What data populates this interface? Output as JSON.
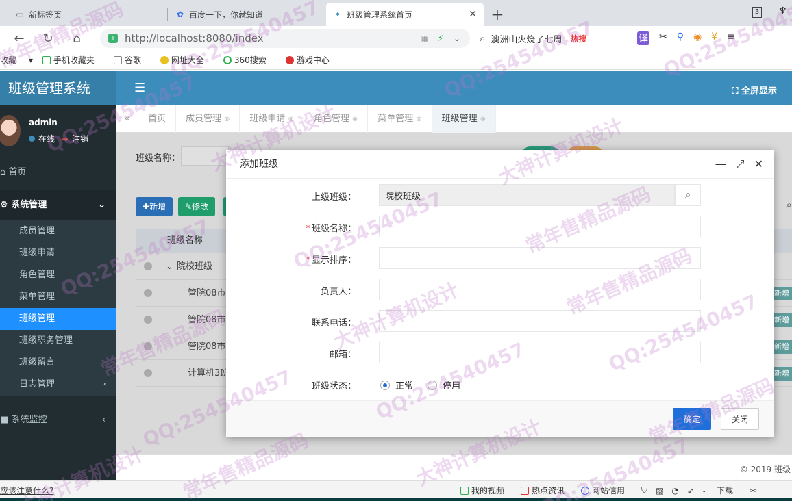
{
  "browser": {
    "tabs": [
      {
        "label": "新标签页",
        "icon": "new-tab-icon"
      },
      {
        "label": "百度一下，你就知道",
        "icon": "baidu-paw-icon"
      },
      {
        "label": "班级管理系统首页",
        "icon": "app-favicon-icon"
      }
    ],
    "url": "http://localhost:8080/index",
    "search_text": "澳洲山火烧了七周",
    "search_hot": "热搜",
    "bookmarks": [
      "收藏",
      "手机收藏夹",
      "谷歌",
      "网址大全",
      "360搜索",
      "游戏中心"
    ]
  },
  "app": {
    "title": "班级管理系统",
    "fullscreen_label": "全屏显示",
    "user": {
      "name": "admin",
      "status": "在线",
      "logout": "注销"
    },
    "sidebar": {
      "home": "首页",
      "system_section": "系统管理",
      "items": [
        "成员管理",
        "班级申请",
        "角色管理",
        "菜单管理",
        "班级管理",
        "班级职务管理",
        "班级留言",
        "日志管理"
      ],
      "active_item": "班级管理",
      "monitor_section": "系统监控"
    },
    "page_tabs": [
      "首页",
      "成员管理",
      "班级申请",
      "角色管理",
      "菜单管理",
      "班级管理"
    ],
    "filter_label": "班级名称：",
    "toolbar": {
      "add": "新增",
      "edit": "修改"
    },
    "table": {
      "header": "班级名称",
      "rows": [
        "院校班级",
        "管院08市",
        "管院08市",
        "管院08市",
        "计算机3班"
      ],
      "row_action": "新增"
    },
    "copyright": "© 2019 班级"
  },
  "modal": {
    "title": "添加班级",
    "fields": {
      "parent": {
        "label": "上级班级：",
        "value": "院校班级"
      },
      "name": {
        "label": "班级名称：",
        "required": true,
        "value": ""
      },
      "order": {
        "label": "显示排序：",
        "required": true,
        "value": ""
      },
      "leader": {
        "label": "负责人：",
        "value": ""
      },
      "phone": {
        "label": "联系电话：",
        "value": ""
      },
      "email": {
        "label": "邮箱：",
        "value": ""
      },
      "status": {
        "label": "班级状态：",
        "options": [
          "正常",
          "停用"
        ],
        "selected": "正常"
      }
    },
    "ok_label": "确定",
    "close_label": "关闭"
  },
  "statusbar": {
    "left": "应该注意什么?",
    "items": [
      "我的视频",
      "热点资讯",
      "网站信用",
      "下载"
    ]
  },
  "watermarks": [
    "QQ:254540457",
    "大神计算机设计",
    "常年售精品源码",
    "大神计算机设计",
    "QQ:254540457",
    "常年售精品源码",
    "QQ:254540457",
    "大神计算机设计",
    "常年售精品源码",
    "QQ:254540457",
    "大神计算机设计",
    "常年售精品源码"
  ]
}
